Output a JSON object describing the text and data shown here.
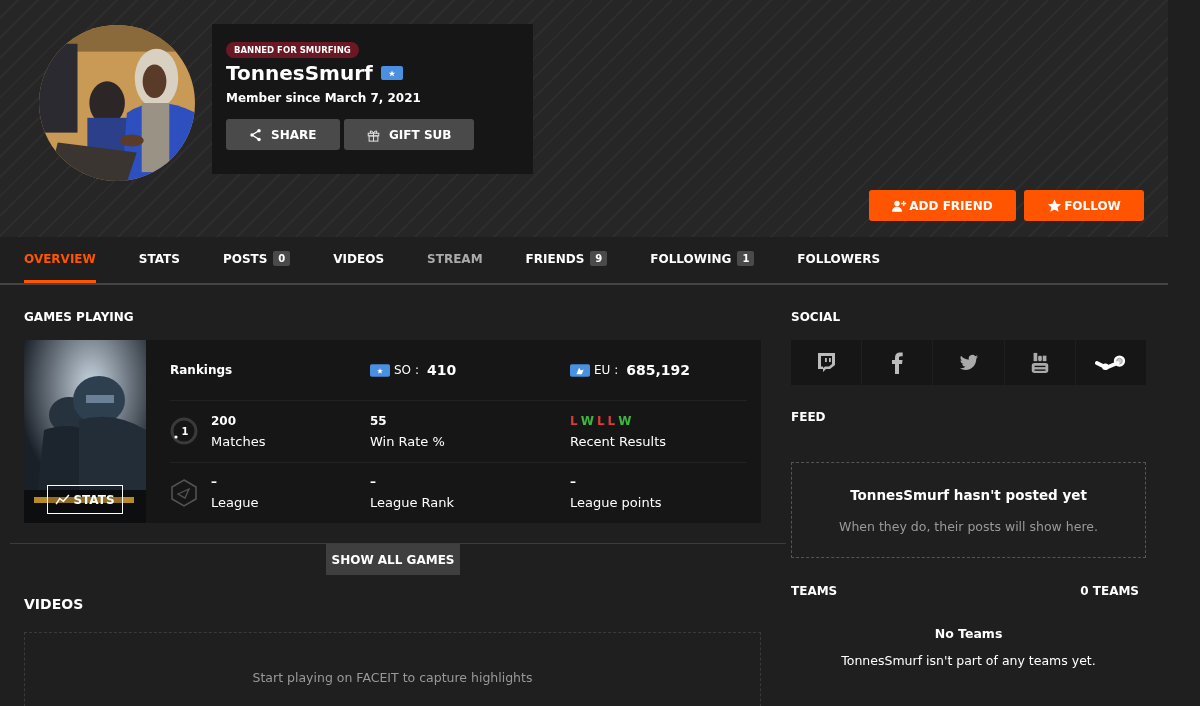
{
  "profile": {
    "ban_badge": "BANNED FOR SMURFING",
    "username": "TonnesSmurf",
    "member_since": "Member since March 7, 2021",
    "buttons": [
      {
        "label": "SHARE",
        "kind": "share"
      },
      {
        "label": "GIFT SUB",
        "kind": "gift"
      }
    ]
  },
  "actions": [
    {
      "label": "ADD FRIEND",
      "kind": "add-friend"
    },
    {
      "label": "FOLLOW",
      "kind": "follow"
    }
  ],
  "tabs": [
    {
      "label": "OVERVIEW",
      "selected": true,
      "disabled": false
    },
    {
      "label": "STATS",
      "selected": false,
      "disabled": false
    },
    {
      "label": "POSTS",
      "count": "0",
      "selected": false,
      "disabled": false
    },
    {
      "label": "VIDEOS",
      "selected": false,
      "disabled": false
    },
    {
      "label": "STREAM",
      "selected": false,
      "disabled": true
    },
    {
      "label": "FRIENDS",
      "count": "9",
      "selected": false,
      "disabled": false
    },
    {
      "label": "FOLLOWING",
      "count": "1",
      "selected": false,
      "disabled": false
    },
    {
      "label": "FOLLOWERS",
      "selected": false,
      "disabled": false
    }
  ],
  "games_playing": {
    "title": "GAMES PLAYING",
    "stats_button": "STATS",
    "rankings_label": "Rankings",
    "rankings": [
      {
        "region": "SO :",
        "value": "410",
        "kind": "country"
      },
      {
        "region": "EU :",
        "value": "685,192",
        "kind": "region"
      }
    ],
    "level": "1",
    "stats": [
      {
        "value": "200",
        "label": "Matches"
      },
      {
        "value": "55",
        "label": "Win Rate %"
      },
      {
        "label": "Recent Results",
        "results": [
          {
            "text": "L",
            "color": "#d83a3a"
          },
          {
            "text": "W",
            "color": "#3fb73f"
          },
          {
            "text": "L",
            "color": "#d83a3a"
          },
          {
            "text": "L",
            "color": "#d83a3a"
          },
          {
            "text": "W",
            "color": "#3fb73f"
          }
        ]
      }
    ],
    "league": [
      {
        "value": "–",
        "label": "League"
      },
      {
        "value": "–",
        "label": "League Rank"
      },
      {
        "value": "–",
        "label": "League points"
      }
    ],
    "show_all": "SHOW ALL GAMES"
  },
  "videos": {
    "title": "VIDEOS",
    "empty": "Start playing on FACEIT to capture highlights"
  },
  "social": {
    "title": "SOCIAL",
    "links": [
      {
        "kind": "twitch"
      },
      {
        "kind": "facebook"
      },
      {
        "kind": "twitter"
      },
      {
        "kind": "youtube"
      },
      {
        "kind": "steam"
      }
    ]
  },
  "feed": {
    "title": "FEED",
    "heading": "TonnesSmurf hasn't posted yet",
    "text": "When they do, their posts will show here."
  },
  "teams": {
    "title": "TEAMS",
    "count": "0 TEAMS",
    "heading": "No Teams",
    "text": "TonnesSmurf isn't part of any teams yet."
  }
}
